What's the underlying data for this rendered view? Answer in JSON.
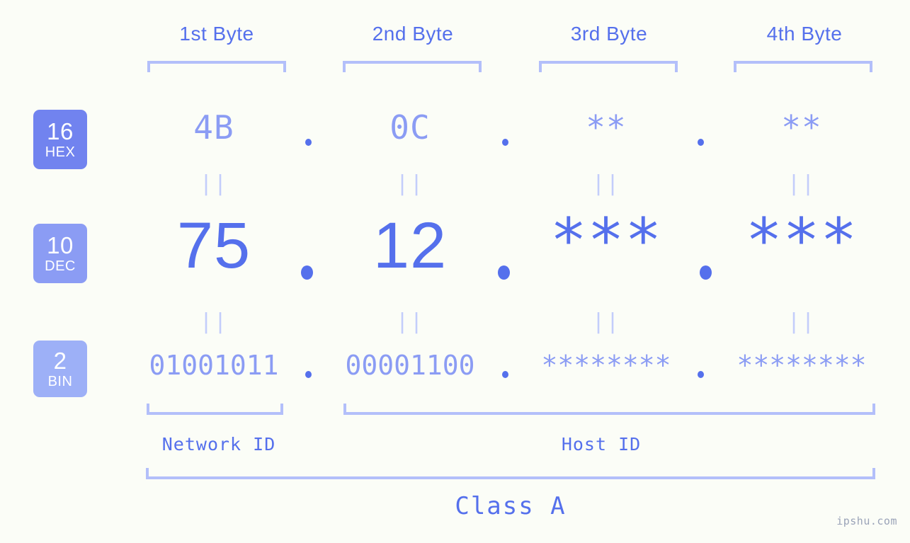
{
  "watermark": "ipshu.com",
  "colors": {
    "background": "#fbfdf7",
    "accent_strong": "#5570ec",
    "accent_mid": "#8b9cf4",
    "accent_light": "#b3bffa",
    "connector": "#c3cdfb",
    "badge_hex": "#7183ef",
    "badge_dec": "#8b9cf4",
    "badge_bin": "#9db0f7"
  },
  "header": {
    "byte_labels": [
      "1st Byte",
      "2nd Byte",
      "3rd Byte",
      "4th Byte"
    ]
  },
  "bases": [
    {
      "num": "16",
      "abbr": "HEX"
    },
    {
      "num": "10",
      "abbr": "DEC"
    },
    {
      "num": "2",
      "abbr": "BIN"
    }
  ],
  "rows": {
    "hex": {
      "base_num": "16",
      "base_abbr": "HEX",
      "values": [
        "4B",
        "0C",
        "**",
        "**"
      ]
    },
    "dec": {
      "base_num": "10",
      "base_abbr": "DEC",
      "values": [
        "75",
        "12",
        "***",
        "***"
      ]
    },
    "bin": {
      "base_num": "2",
      "base_abbr": "BIN",
      "values": [
        "01001011",
        "00001100",
        "********",
        "********"
      ]
    }
  },
  "separators": {
    "dot": "."
  },
  "connector": {
    "symbol": "||"
  },
  "footer": {
    "network_id_label": "Network ID",
    "host_id_label": "Host ID",
    "class_label": "Class A"
  }
}
